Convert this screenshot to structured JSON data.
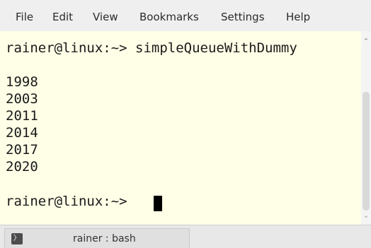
{
  "menubar": {
    "items": [
      "File",
      "Edit",
      "View",
      "Bookmarks",
      "Settings",
      "Help"
    ]
  },
  "terminal": {
    "lines": [
      "rainer@linux:~> simpleQueueWithDummy",
      "",
      "1998",
      "2003",
      "2011",
      "2014",
      "2017",
      "2020",
      "",
      "rainer@linux:~> "
    ]
  },
  "tabbar": {
    "tab_label": "rainer : bash"
  },
  "icons": {
    "tab_icon": "terminal-icon",
    "scroll_up": "chevron-up-icon",
    "scroll_down": "chevron-down-icon"
  },
  "colors": {
    "terminal_background": "#fffee6",
    "terminal_text": "#1a1a1a",
    "chrome": "#efefef"
  }
}
